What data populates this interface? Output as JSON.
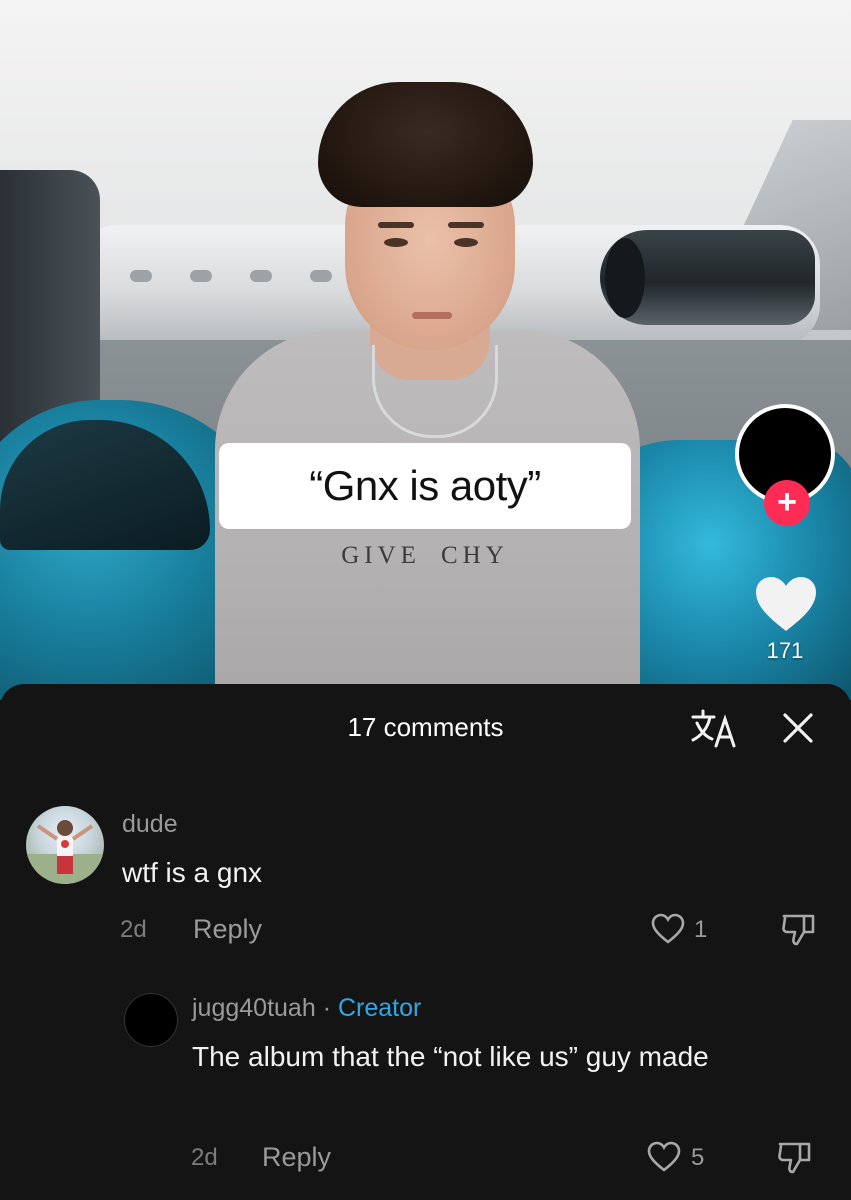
{
  "video": {
    "caption": "“Gnx is aoty”",
    "shirt_text": "GIVE  CHY",
    "like_count": "171",
    "follow_icon": "plus-icon"
  },
  "comments_panel": {
    "title": "17 comments",
    "translate_icon": "translate-icon",
    "close_icon": "close-icon",
    "comments": [
      {
        "username": "dude",
        "text": "wtf is a gnx",
        "time": "2d",
        "reply_label": "Reply",
        "likes": "1"
      }
    ],
    "replies": [
      {
        "username": "jugg40tuah",
        "separator": "·",
        "badge": "Creator",
        "text": "The album that the “not like us” guy made",
        "time": "2d",
        "reply_label": "Reply",
        "likes": "5"
      }
    ]
  },
  "colors": {
    "panel_bg": "#141414",
    "accent_red": "#fe2c55",
    "creator_blue": "#32a7e6"
  }
}
